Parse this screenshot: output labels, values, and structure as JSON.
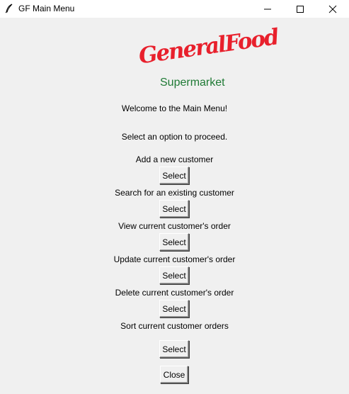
{
  "window": {
    "title": "GF Main Menu",
    "icon": "feather-icon",
    "controls": [
      "minimize-icon",
      "maximize-icon",
      "close-icon"
    ]
  },
  "logo": {
    "brand_line": "GeneralFood",
    "sub_line": "Supermarket",
    "brand_color": "#e8202c",
    "sub_color": "#1f7a35"
  },
  "main": {
    "welcome": "Welcome to the Main Menu!",
    "instruction": "Select an option to proceed.",
    "options": [
      {
        "label": "Add a new customer",
        "button": "Select"
      },
      {
        "label": "Search for an existing customer",
        "button": "Select"
      },
      {
        "label": "View current customer's order",
        "button": "Select"
      },
      {
        "label": "Update current customer's order",
        "button": "Select"
      },
      {
        "label": "Delete current customer's order",
        "button": "Select"
      },
      {
        "label": "Sort current customer orders",
        "button": "Select"
      }
    ],
    "close_label": "Close"
  }
}
